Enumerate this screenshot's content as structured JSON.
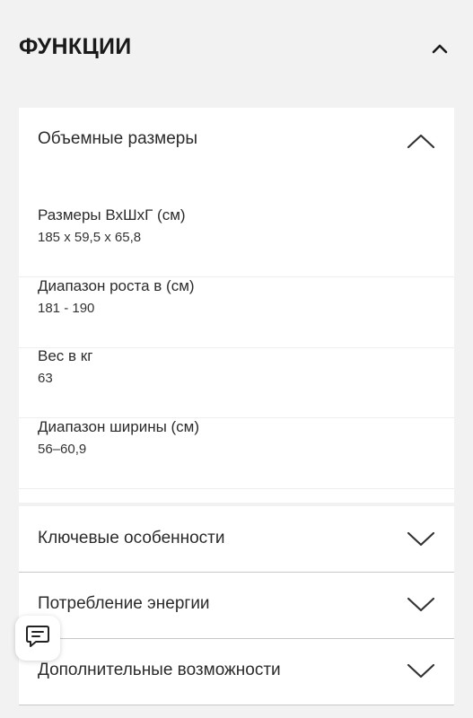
{
  "section": {
    "title": "ФУНКЦИИ",
    "toggle_icon": "chevron-up-icon"
  },
  "dimensions_panel": {
    "title": "Объемные размеры",
    "toggle_icon": "chevron-up-icon",
    "specs": [
      {
        "label": "Размеры ВхШхГ (см)",
        "value": "185 x 59,5 x 65,8"
      },
      {
        "label": "Диапазон роста в (см)",
        "value": "181 - 190"
      },
      {
        "label": "Вес в кг",
        "value": "63"
      },
      {
        "label": "Диапазон ширины (см)",
        "value": "56–60,9"
      }
    ]
  },
  "collapsed_panels": [
    {
      "title": "Ключевые особенности",
      "toggle_icon": "chevron-down-icon"
    },
    {
      "title": "Потребление энергии",
      "toggle_icon": "chevron-down-icon"
    },
    {
      "title": "Дополнительные возможности",
      "toggle_icon": "chevron-down-icon"
    }
  ],
  "chat_button": {
    "icon": "chat-icon"
  },
  "colors": {
    "page_background": "#f2f2f2",
    "card_background": "#ffffff",
    "text": "#222222",
    "divider": "#c8c8c8"
  }
}
